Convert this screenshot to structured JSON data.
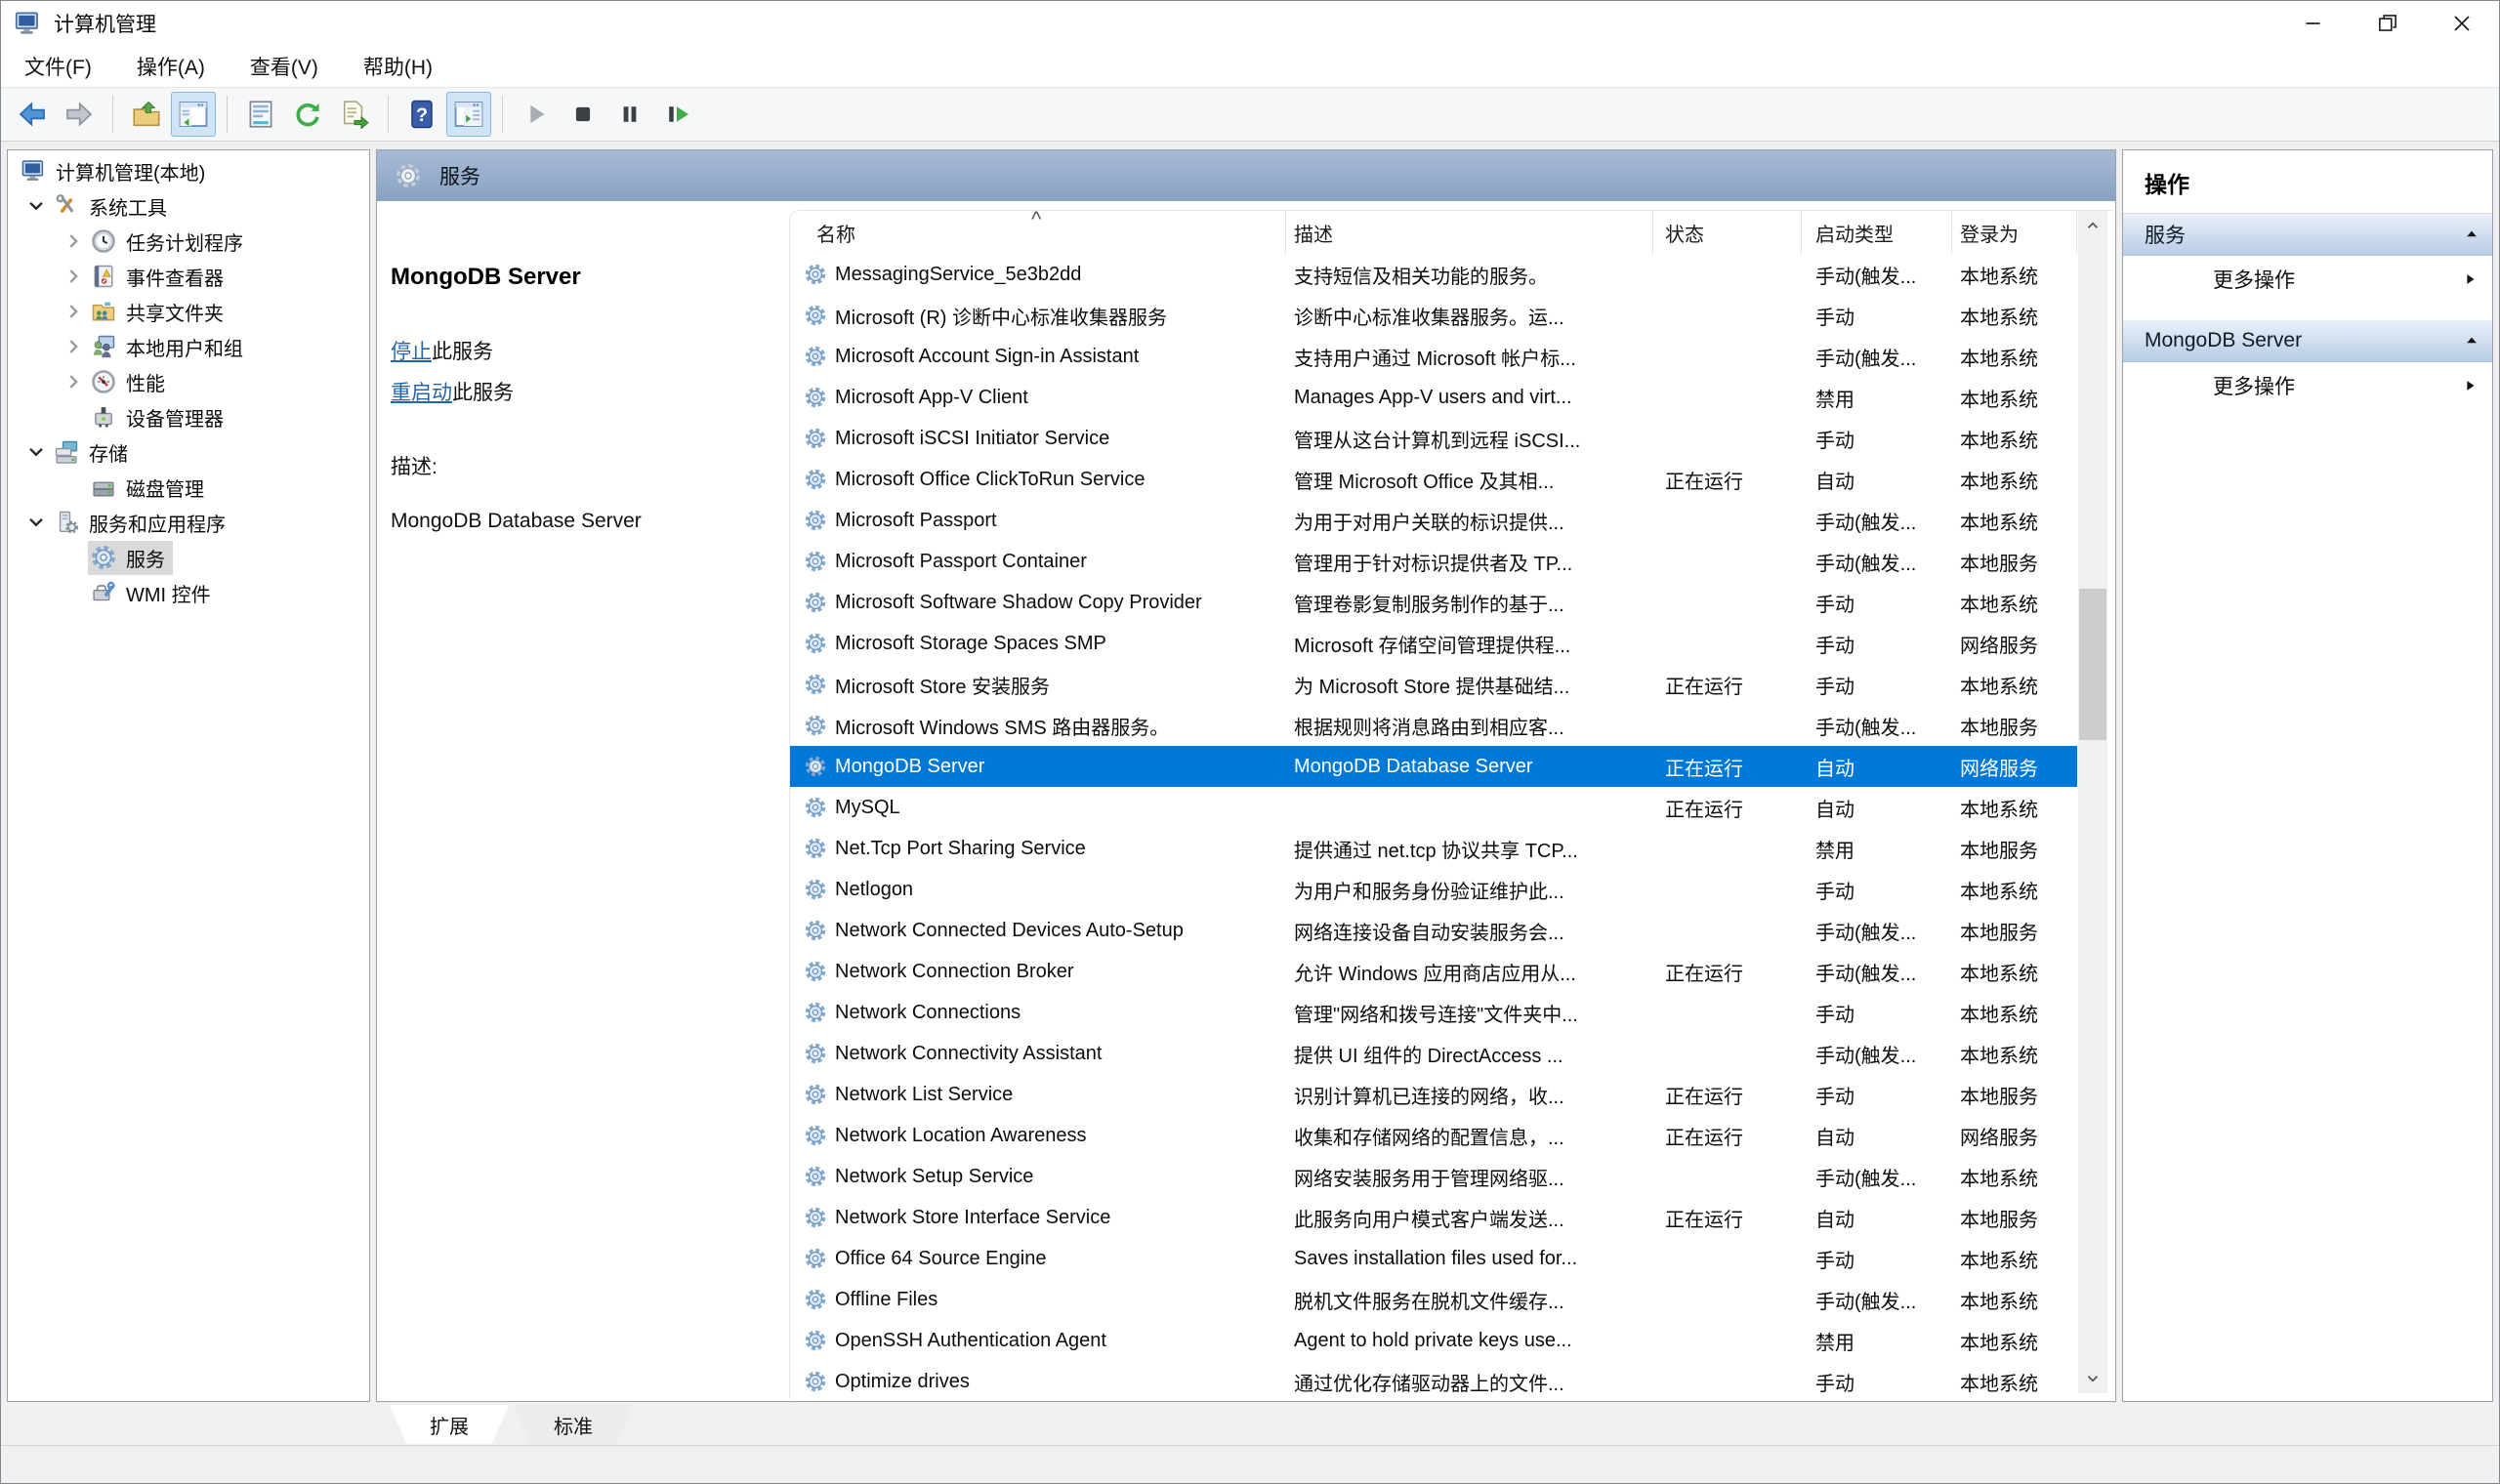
{
  "window": {
    "title": "计算机管理",
    "icon": "computer",
    "controls": [
      {
        "icon": "minimize"
      },
      {
        "icon": "restore"
      },
      {
        "icon": "close"
      }
    ]
  },
  "menu": {
    "items": [
      {
        "label": "文件(F)"
      },
      {
        "label": "操作(A)"
      },
      {
        "label": "查看(V)"
      },
      {
        "label": "帮助(H)"
      }
    ]
  },
  "toolbar": {
    "buttons": [
      {
        "icon": "back-arrow"
      },
      {
        "icon": "forward-arrow"
      },
      {
        "icon": "",
        "sep": true
      },
      {
        "icon": "open-folder"
      },
      {
        "icon": "show-console-tree",
        "pressed": true
      },
      {
        "icon": "",
        "sep": true
      },
      {
        "icon": "properties"
      },
      {
        "icon": "refresh"
      },
      {
        "icon": "export-list"
      },
      {
        "icon": "",
        "sep": true
      },
      {
        "icon": "help"
      },
      {
        "icon": "show-action-pane",
        "pressed": true
      },
      {
        "icon": "",
        "sep": true
      },
      {
        "icon": "start-service"
      },
      {
        "icon": "stop-service"
      },
      {
        "icon": "pause-service"
      },
      {
        "icon": "resume-service"
      }
    ]
  },
  "tree": {
    "items": [
      {
        "depth": 0,
        "expander": "",
        "icon": "computer",
        "label": "计算机管理(本地)"
      },
      {
        "depth": 1,
        "expander": "chevron-down",
        "icon": "system-tools",
        "label": "系统工具"
      },
      {
        "depth": 2,
        "expander": "chevron-right",
        "icon": "task-scheduler",
        "label": "任务计划程序"
      },
      {
        "depth": 2,
        "expander": "chevron-right",
        "icon": "event-viewer",
        "label": "事件查看器"
      },
      {
        "depth": 2,
        "expander": "chevron-right",
        "icon": "shared-folders",
        "label": "共享文件夹"
      },
      {
        "depth": 2,
        "expander": "chevron-right",
        "icon": "local-users",
        "label": "本地用户和组"
      },
      {
        "depth": 2,
        "expander": "chevron-right",
        "icon": "performance",
        "label": "性能"
      },
      {
        "depth": 2,
        "expander": "",
        "icon": "device-manager",
        "label": "设备管理器"
      },
      {
        "depth": 1,
        "expander": "chevron-down",
        "icon": "storage",
        "label": "存储"
      },
      {
        "depth": 2,
        "expander": "",
        "icon": "disk-management",
        "label": "磁盘管理"
      },
      {
        "depth": 1,
        "expander": "chevron-down",
        "icon": "services-apps",
        "label": "服务和应用程序"
      },
      {
        "depth": 2,
        "expander": "",
        "icon": "services-gear",
        "label": "服务",
        "selected": true
      },
      {
        "depth": 2,
        "expander": "",
        "icon": "wmi-control",
        "label": "WMI 控件"
      }
    ]
  },
  "content": {
    "header": "服务",
    "header_icon": "header-gear",
    "info": {
      "service_name": "MongoDB Server",
      "stop_link": "停止",
      "stop_rest": "此服务",
      "restart_link": "重启动",
      "restart_rest": "此服务",
      "description_label": "描述:",
      "description": "MongoDB Database Server"
    },
    "table": {
      "sort_glyph": "^",
      "row_icon": "service-gear",
      "scrollbar": {
        "up_icon": "scroll-up",
        "down_icon": "scroll-down"
      },
      "columns": [
        {
          "key": "name",
          "label": "名称"
        },
        {
          "key": "desc",
          "label": "描述"
        },
        {
          "key": "status",
          "label": "状态"
        },
        {
          "key": "startup",
          "label": "启动类型"
        },
        {
          "key": "logon",
          "label": "登录为"
        }
      ],
      "rows": [
        {
          "name": "MessagingService_5e3b2dd",
          "desc": "支持短信及相关功能的服务。",
          "status": "",
          "startup": "手动(触发...",
          "logon": "本地系统"
        },
        {
          "name": "Microsoft (R) 诊断中心标准收集器服务",
          "desc": "诊断中心标准收集器服务。运...",
          "status": "",
          "startup": "手动",
          "logon": "本地系统"
        },
        {
          "name": "Microsoft Account Sign-in Assistant",
          "desc": "支持用户通过 Microsoft 帐户标...",
          "status": "",
          "startup": "手动(触发...",
          "logon": "本地系统"
        },
        {
          "name": "Microsoft App-V Client",
          "desc": "Manages App-V users and virt...",
          "status": "",
          "startup": "禁用",
          "logon": "本地系统"
        },
        {
          "name": "Microsoft iSCSI Initiator Service",
          "desc": "管理从这台计算机到远程 iSCSI...",
          "status": "",
          "startup": "手动",
          "logon": "本地系统"
        },
        {
          "name": "Microsoft Office ClickToRun Service",
          "desc": "管理 Microsoft Office 及其相...",
          "status": "正在运行",
          "startup": "自动",
          "logon": "本地系统"
        },
        {
          "name": "Microsoft Passport",
          "desc": "为用于对用户关联的标识提供...",
          "status": "",
          "startup": "手动(触发...",
          "logon": "本地系统"
        },
        {
          "name": "Microsoft Passport Container",
          "desc": "管理用于针对标识提供者及 TP...",
          "status": "",
          "startup": "手动(触发...",
          "logon": "本地服务"
        },
        {
          "name": "Microsoft Software Shadow Copy Provider",
          "desc": "管理卷影复制服务制作的基于...",
          "status": "",
          "startup": "手动",
          "logon": "本地系统"
        },
        {
          "name": "Microsoft Storage Spaces SMP",
          "desc": "Microsoft 存储空间管理提供程...",
          "status": "",
          "startup": "手动",
          "logon": "网络服务"
        },
        {
          "name": "Microsoft Store 安装服务",
          "desc": "为 Microsoft Store 提供基础结...",
          "status": "正在运行",
          "startup": "手动",
          "logon": "本地系统"
        },
        {
          "name": "Microsoft Windows SMS 路由器服务。",
          "desc": "根据规则将消息路由到相应客...",
          "status": "",
          "startup": "手动(触发...",
          "logon": "本地服务"
        },
        {
          "name": "MongoDB Server",
          "desc": "MongoDB Database Server",
          "status": "正在运行",
          "startup": "自动",
          "logon": "网络服务",
          "selected": true
        },
        {
          "name": "MySQL",
          "desc": "",
          "status": "正在运行",
          "startup": "自动",
          "logon": "本地系统"
        },
        {
          "name": "Net.Tcp Port Sharing Service",
          "desc": "提供通过 net.tcp 协议共享 TCP...",
          "status": "",
          "startup": "禁用",
          "logon": "本地服务"
        },
        {
          "name": "Netlogon",
          "desc": "为用户和服务身份验证维护此...",
          "status": "",
          "startup": "手动",
          "logon": "本地系统"
        },
        {
          "name": "Network Connected Devices Auto-Setup",
          "desc": "网络连接设备自动安装服务会...",
          "status": "",
          "startup": "手动(触发...",
          "logon": "本地服务"
        },
        {
          "name": "Network Connection Broker",
          "desc": "允许 Windows 应用商店应用从...",
          "status": "正在运行",
          "startup": "手动(触发...",
          "logon": "本地系统"
        },
        {
          "name": "Network Connections",
          "desc": "管理\"网络和拨号连接\"文件夹中...",
          "status": "",
          "startup": "手动",
          "logon": "本地系统"
        },
        {
          "name": "Network Connectivity Assistant",
          "desc": "提供 UI 组件的 DirectAccess ...",
          "status": "",
          "startup": "手动(触发...",
          "logon": "本地系统"
        },
        {
          "name": "Network List Service",
          "desc": "识别计算机已连接的网络，收...",
          "status": "正在运行",
          "startup": "手动",
          "logon": "本地服务"
        },
        {
          "name": "Network Location Awareness",
          "desc": "收集和存储网络的配置信息，...",
          "status": "正在运行",
          "startup": "自动",
          "logon": "网络服务"
        },
        {
          "name": "Network Setup Service",
          "desc": "网络安装服务用于管理网络驱...",
          "status": "",
          "startup": "手动(触发...",
          "logon": "本地系统"
        },
        {
          "name": "Network Store Interface Service",
          "desc": "此服务向用户模式客户端发送...",
          "status": "正在运行",
          "startup": "自动",
          "logon": "本地服务"
        },
        {
          "name": "Office 64 Source Engine",
          "desc": "Saves installation files used for...",
          "status": "",
          "startup": "手动",
          "logon": "本地系统"
        },
        {
          "name": "Offline Files",
          "desc": "脱机文件服务在脱机文件缓存...",
          "status": "",
          "startup": "手动(触发...",
          "logon": "本地系统"
        },
        {
          "name": "OpenSSH Authentication Agent",
          "desc": "Agent to hold private keys use...",
          "status": "",
          "startup": "禁用",
          "logon": "本地系统"
        },
        {
          "name": "Optimize drives",
          "desc": "通过优化存储驱动器上的文件...",
          "status": "",
          "startup": "手动",
          "logon": "本地系统"
        }
      ]
    }
  },
  "actions": {
    "title": "操作",
    "sections": [
      {
        "label": "服务",
        "item": "更多操作",
        "collapse_icon": "collapse-arrow",
        "submenu_icon": "submenu-arrow"
      },
      {
        "label": "MongoDB Server",
        "item": "更多操作",
        "collapse_icon": "collapse-arrow",
        "submenu_icon": "submenu-arrow"
      }
    ]
  },
  "tabs": {
    "items": [
      {
        "label": "扩展",
        "active": true
      },
      {
        "label": "标准"
      }
    ]
  }
}
